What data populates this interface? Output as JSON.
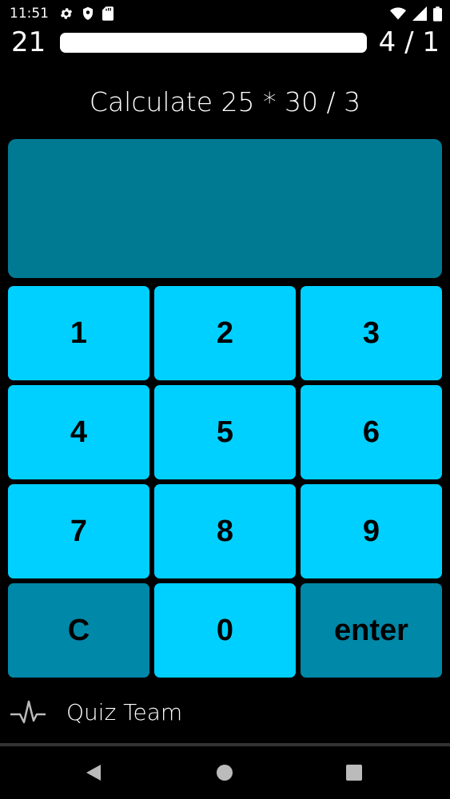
{
  "status_bar": {
    "time": "11:51",
    "left_icons": [
      "gear-icon",
      "shield-icon",
      "sd-card-icon"
    ],
    "right_icons": [
      "wifi-icon",
      "cellular-icon",
      "battery-icon"
    ]
  },
  "header": {
    "score_left": "21",
    "score_right": "4 / 1",
    "progress_fraction": 0.0
  },
  "question": {
    "text": "Calculate 25 * 30 / 3"
  },
  "answer": {
    "value": ""
  },
  "keypad": {
    "keys": [
      {
        "label": "1",
        "variant": "light"
      },
      {
        "label": "2",
        "variant": "light"
      },
      {
        "label": "3",
        "variant": "light"
      },
      {
        "label": "4",
        "variant": "light"
      },
      {
        "label": "5",
        "variant": "light"
      },
      {
        "label": "6",
        "variant": "light"
      },
      {
        "label": "7",
        "variant": "light"
      },
      {
        "label": "8",
        "variant": "light"
      },
      {
        "label": "9",
        "variant": "light"
      },
      {
        "label": "C",
        "variant": "dark"
      },
      {
        "label": "0",
        "variant": "light"
      },
      {
        "label": "enter",
        "variant": "dark"
      }
    ]
  },
  "footer": {
    "icon": "pulse-icon",
    "label": "Quiz Team"
  },
  "nav": {
    "icons": [
      "back-triangle-icon",
      "home-circle-icon",
      "recents-square-icon"
    ]
  },
  "colors": {
    "background": "#000000",
    "display": "#007a93",
    "key_light": "#00d0ff",
    "key_dark": "#0088a8",
    "text_primary": "#ffffff",
    "key_text": "#000000"
  }
}
